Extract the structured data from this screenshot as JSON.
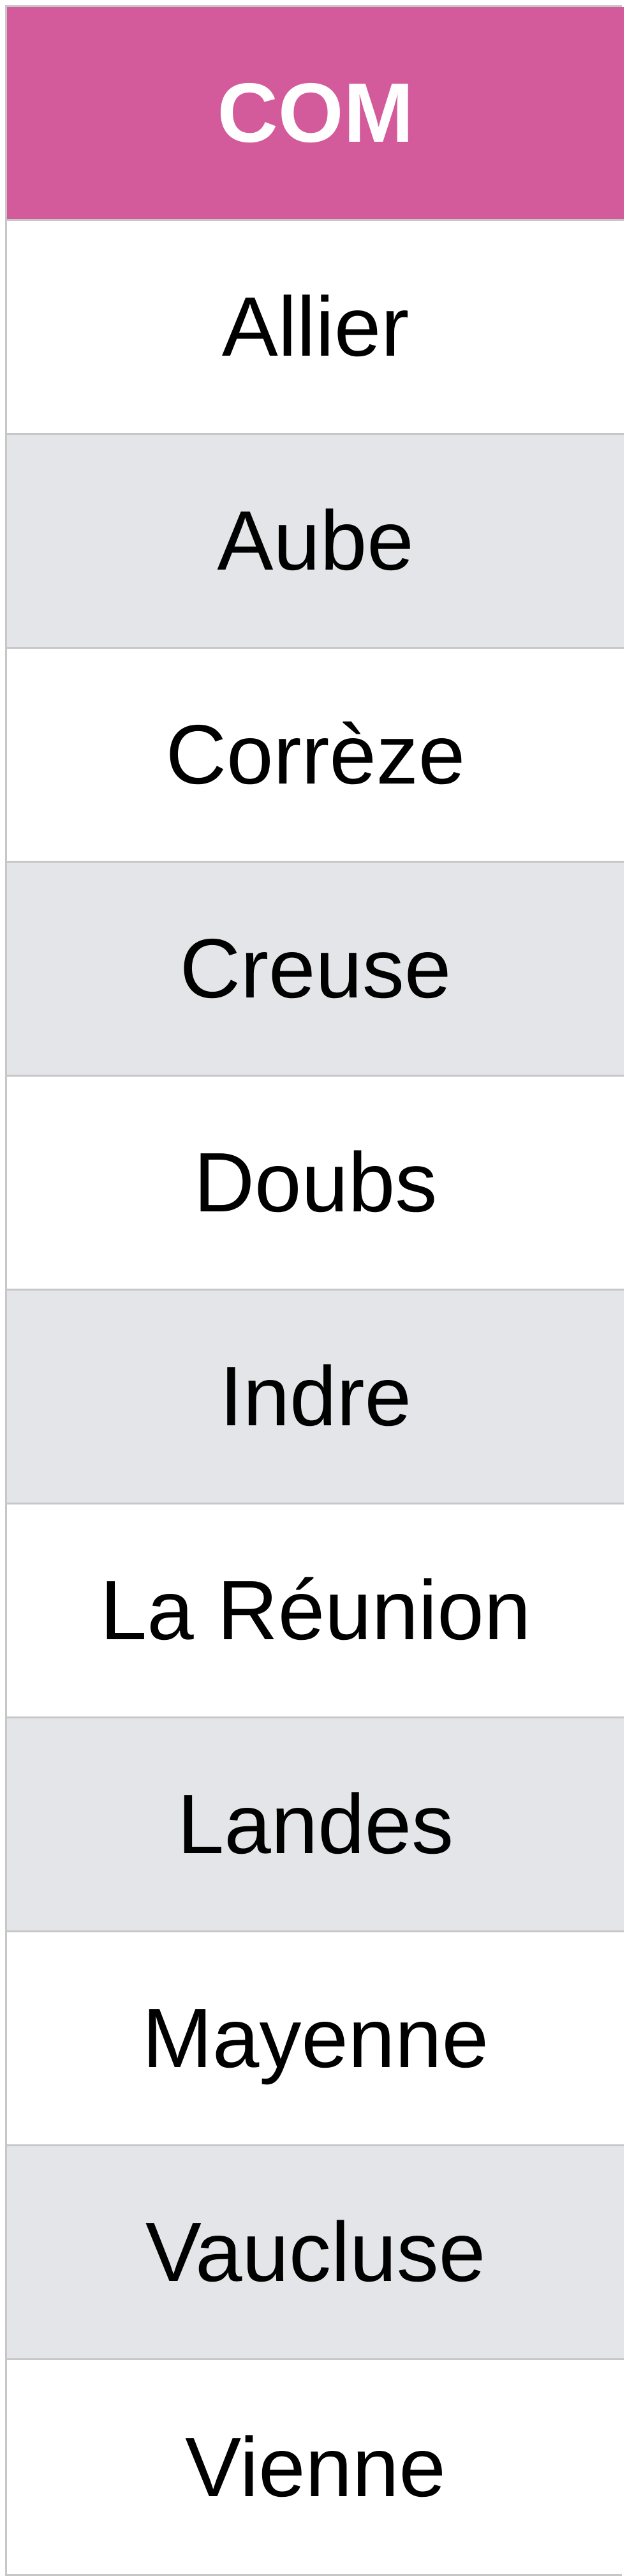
{
  "table": {
    "header": "COM",
    "header_color": "#d35b9b",
    "rows": [
      {
        "label": "Allier",
        "shade": "#ffffff"
      },
      {
        "label": "Aube",
        "shade": "#e4e5e8"
      },
      {
        "label": "Corrèze",
        "shade": "#ffffff"
      },
      {
        "label": "Creuse",
        "shade": "#e4e5e8"
      },
      {
        "label": "Doubs",
        "shade": "#ffffff"
      },
      {
        "label": "Indre",
        "shade": "#e4e5e8"
      },
      {
        "label": "La Réunion",
        "shade": "#ffffff"
      },
      {
        "label": "Landes",
        "shade": "#e4e5e8"
      },
      {
        "label": "Mayenne",
        "shade": "#ffffff"
      },
      {
        "label": "Vaucluse",
        "shade": "#e4e5e8"
      },
      {
        "label": "Vienne",
        "shade": "#ffffff"
      }
    ]
  }
}
